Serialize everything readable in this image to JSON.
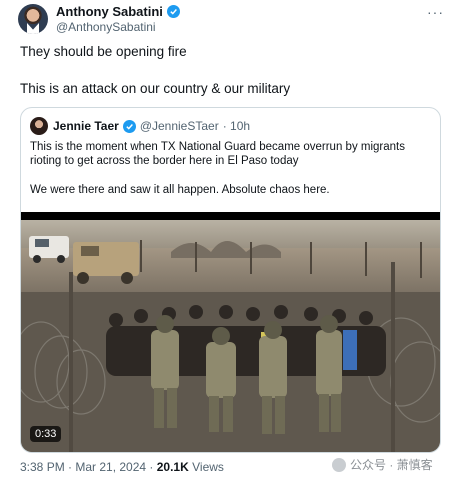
{
  "tweet": {
    "author_name": "Anthony Sabatini",
    "author_handle": "@AnthonySabatini",
    "more_label": "···",
    "lines": [
      "They should be opening fire",
      "This is an attack on our country & our military"
    ],
    "timestamp": "3:38 PM · Mar 21, 2024 ·",
    "views_count": "20.1K",
    "views_label": "Views"
  },
  "quote": {
    "author_name": "Jennie Taer",
    "author_handle": "@JennieSTaer",
    "age": "· 10h",
    "lines": [
      "This is the moment when TX National Guard became overrun by migrants",
      "rioting to get across the border here in El Paso today",
      "We were there and saw it all happen. Absolute chaos here."
    ],
    "video_duration": "0:33"
  },
  "watermark": {
    "text": "公众号 · 萧慎客"
  },
  "colors": {
    "verified_blue": "#1d9bf0",
    "secondary_text": "#536471",
    "border": "#cfd9de"
  }
}
